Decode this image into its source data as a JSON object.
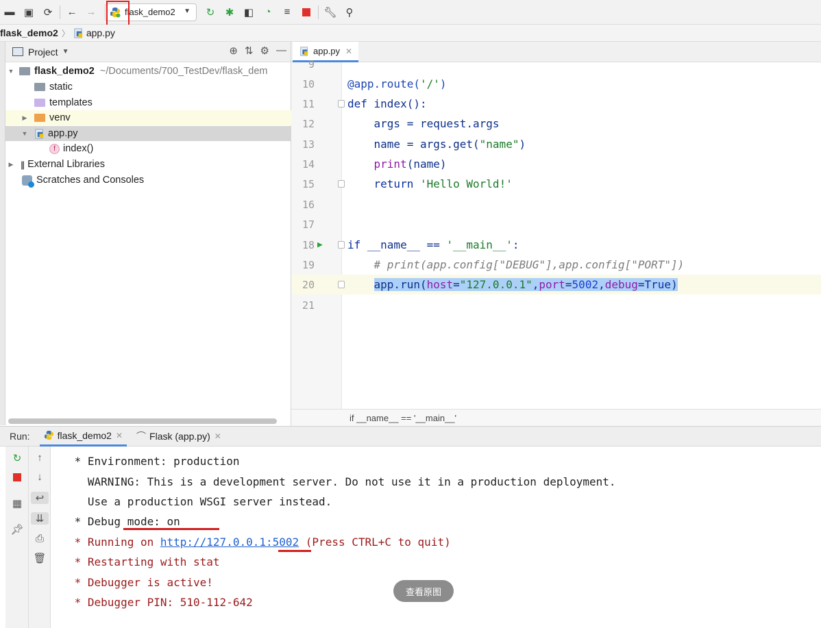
{
  "toolbar": {
    "run_config": "flask_demo2"
  },
  "breadcrumb": {
    "project": "flask_demo2",
    "file": "app.py"
  },
  "project_panel": {
    "title": "Project",
    "tree": [
      {
        "label": "flask_demo2",
        "extra": "~/Documents/700_TestDev/flask_dem"
      },
      {
        "label": "static"
      },
      {
        "label": "templates"
      },
      {
        "label": "venv"
      },
      {
        "label": "app.py"
      },
      {
        "label": "index()"
      },
      {
        "label": "External Libraries"
      },
      {
        "label": "Scratches and Consoles"
      }
    ]
  },
  "editor": {
    "tab": "app.py",
    "status": "if __name__ == '__main__'",
    "line_numbers": [
      "9",
      "10",
      "11",
      "12",
      "13",
      "14",
      "15",
      "16",
      "17",
      "18",
      "19",
      "20",
      "21"
    ]
  },
  "run_panel": {
    "label": "Run:",
    "tabs": [
      "flask_demo2",
      "Flask (app.py)"
    ],
    "lines": [
      " * Environment: production",
      "   WARNING: This is a development server. Do not use it in a production deployment.",
      "   Use a production WSGI server instead.",
      " * Debug mode: on",
      " * Restarting with stat",
      " * Debugger is active!",
      " * Debugger PIN: 510-112-642"
    ],
    "running_prefix": " * Running on ",
    "running_url": "http://127.0.0.1:5002",
    "running_suffix": " (Press CTRL+C to quit)"
  },
  "watermark": "查看原图",
  "colors": {
    "annotation_red": "#d11d1d",
    "accent_blue": "#4a87dd"
  }
}
